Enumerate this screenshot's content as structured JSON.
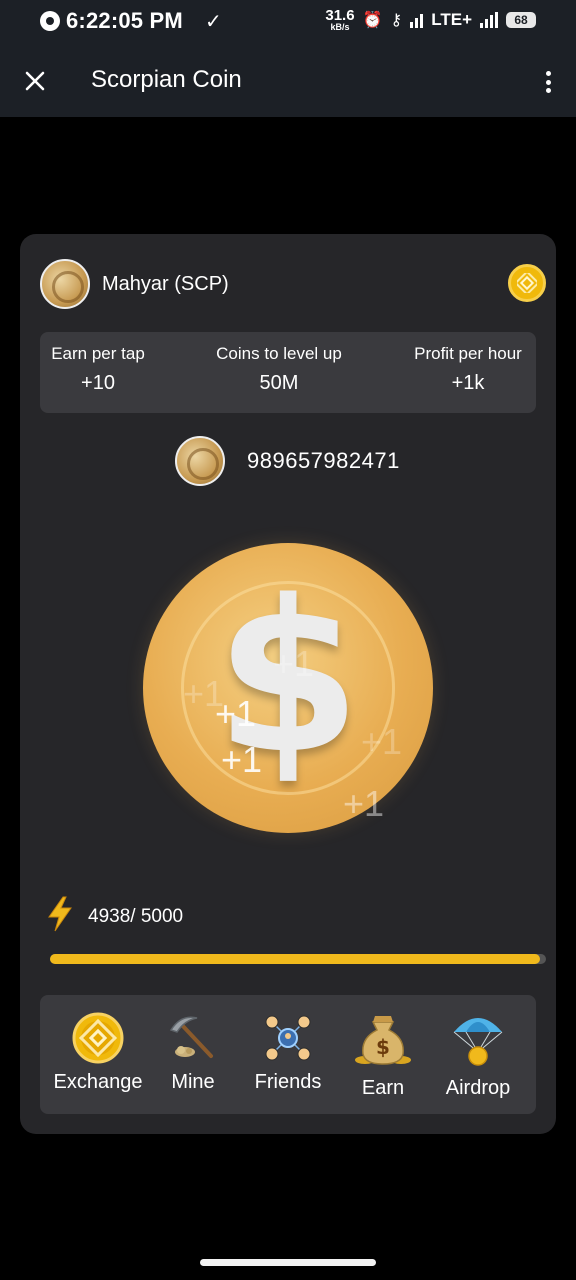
{
  "status_bar": {
    "time": "6:22:05 PM",
    "speed_value": "31.6",
    "speed_unit": "kB/s",
    "network": "LTE+",
    "battery": "68"
  },
  "app_bar": {
    "title": "Scorpian Coin"
  },
  "user": {
    "name": "Mahyar (SCP)"
  },
  "stats": [
    {
      "label": "Earn per tap",
      "value": "+10"
    },
    {
      "label": "Coins to level up",
      "value": "50M"
    },
    {
      "label": "Profit per hour",
      "value": "+1k"
    }
  ],
  "balance": "989657982471",
  "tap_coin": {
    "plus_labels": [
      "+1",
      "+1",
      "+1",
      "+1",
      "+1",
      "+1"
    ]
  },
  "energy": {
    "text": "4938/ 5000",
    "current": 4938,
    "max": 5000
  },
  "nav": [
    {
      "label": "Exchange",
      "icon": "exchange-icon"
    },
    {
      "label": "Mine",
      "icon": "pickaxe-icon"
    },
    {
      "label": "Friends",
      "icon": "friends-icon"
    },
    {
      "label": "Earn",
      "icon": "money-bag-icon"
    },
    {
      "label": "Airdrop",
      "icon": "parachute-icon"
    }
  ],
  "colors": {
    "background": "#000000",
    "bar": "#1c2026",
    "card": "#262629",
    "panel": "#3a3a3e",
    "accent": "#f0b91c",
    "coin": "#e8ad52"
  }
}
